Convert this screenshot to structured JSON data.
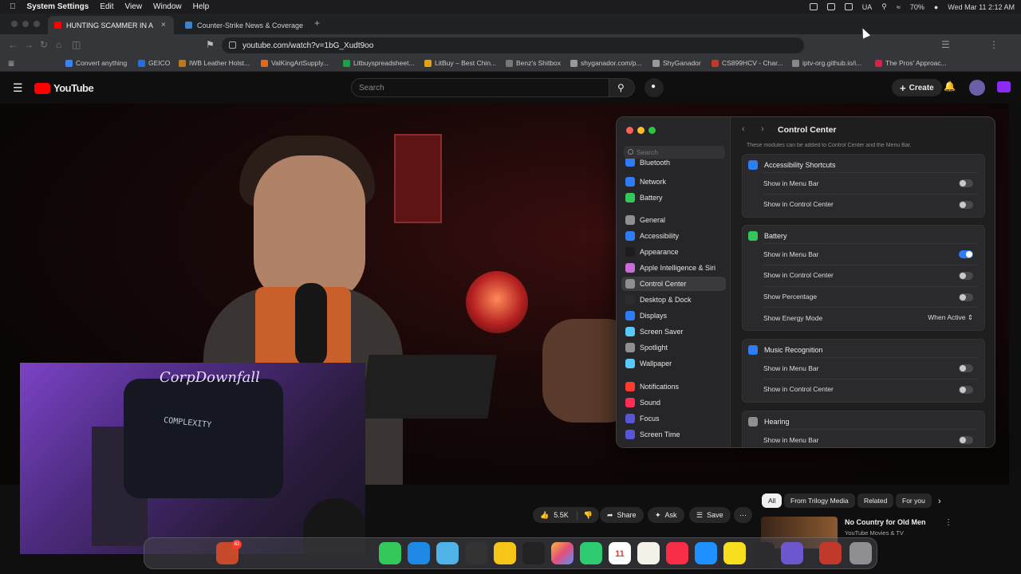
{
  "menubar": {
    "items": [
      "System Settings",
      "Edit",
      "View",
      "Window",
      "Help"
    ],
    "status": {
      "input": "UA",
      "battery": "70%",
      "datetime": "Wed Mar 11  2:12 AM"
    }
  },
  "tabs": [
    {
      "title": "HUNTING SCAMMER IN A",
      "active": true
    },
    {
      "title": "Counter-Strike News & Coverage",
      "active": false
    }
  ],
  "address": {
    "url": "youtube.com/watch?v=1bG_Xudt9oo"
  },
  "bookmarks": [
    "Convert anything",
    "GEICO",
    "IWB Leather Holst...",
    "ValKingArtSupply...",
    "Litbuyspreadsheet...",
    "LitBuy – Best Chin...",
    "Benz's Shitbox",
    "shyganador.com/p...",
    "ShyGanador",
    "CS899HCV - Char...",
    "iptv-org.github.io/i...",
    "The Pros' Approac..."
  ],
  "youtube": {
    "logo": "YouTube",
    "search_placeholder": "Search",
    "create_label": "Create",
    "video_overlay_sig": "CorpDownfall",
    "shirt_text": "COMPLEXITY",
    "actions": {
      "likes": "5.5K",
      "share": "Share",
      "ask": "Ask",
      "save": "Save"
    },
    "chips": [
      "All",
      "From Trilogy Media",
      "Related",
      "For you"
    ],
    "rec": {
      "title": "No Country for Old Men",
      "channel": "YouTube Movies & TV"
    }
  },
  "settings": {
    "search_placeholder": "Search",
    "title": "Control Center",
    "hint": "These modules can be added to Control Center and the Menu Bar.",
    "sidebar": [
      {
        "label": "Bluetooth",
        "color": "#2f7df6"
      },
      {
        "label": "Network",
        "color": "#2f7df6"
      },
      {
        "label": "Battery",
        "color": "#34c759"
      },
      {
        "label": "General",
        "color": "#8e8e93"
      },
      {
        "label": "Accessibility",
        "color": "#2f7df6"
      },
      {
        "label": "Appearance",
        "color": "#1c1c1e"
      },
      {
        "label": "Apple Intelligence & Siri",
        "color": "#c86dd7"
      },
      {
        "label": "Control Center",
        "color": "#8e8e93",
        "selected": true
      },
      {
        "label": "Desktop & Dock",
        "color": "#2c2c2e"
      },
      {
        "label": "Displays",
        "color": "#2f7df6"
      },
      {
        "label": "Screen Saver",
        "color": "#5ac8fa"
      },
      {
        "label": "Spotlight",
        "color": "#8e8e93"
      },
      {
        "label": "Wallpaper",
        "color": "#5ac8fa"
      },
      {
        "label": "Notifications",
        "color": "#ff3b30"
      },
      {
        "label": "Sound",
        "color": "#ff2d55"
      },
      {
        "label": "Focus",
        "color": "#5856d6"
      },
      {
        "label": "Screen Time",
        "color": "#5856d6"
      }
    ],
    "groups": [
      {
        "title": "Accessibility Shortcuts",
        "icon_color": "#2f7df6",
        "rows": [
          {
            "label": "Show in Menu Bar",
            "on": false
          },
          {
            "label": "Show in Control Center",
            "on": false
          }
        ]
      },
      {
        "title": "Battery",
        "icon_color": "#34c759",
        "rows": [
          {
            "label": "Show in Menu Bar",
            "on": true
          },
          {
            "label": "Show in Control Center",
            "on": false
          },
          {
            "label": "Show Percentage",
            "on": false
          },
          {
            "label": "Show Energy Mode",
            "popup": "When Active"
          }
        ]
      },
      {
        "title": "Music Recognition",
        "icon_color": "#2f7df6",
        "rows": [
          {
            "label": "Show in Menu Bar",
            "on": false
          },
          {
            "label": "Show in Control Center",
            "on": false
          }
        ]
      },
      {
        "title": "Hearing",
        "icon_color": "#8e8e93",
        "rows": [
          {
            "label": "Show in Menu Bar",
            "on": false
          }
        ]
      }
    ]
  },
  "dock": {
    "calendar_month": "MAR",
    "calendar_day": "11",
    "badge": "83"
  }
}
